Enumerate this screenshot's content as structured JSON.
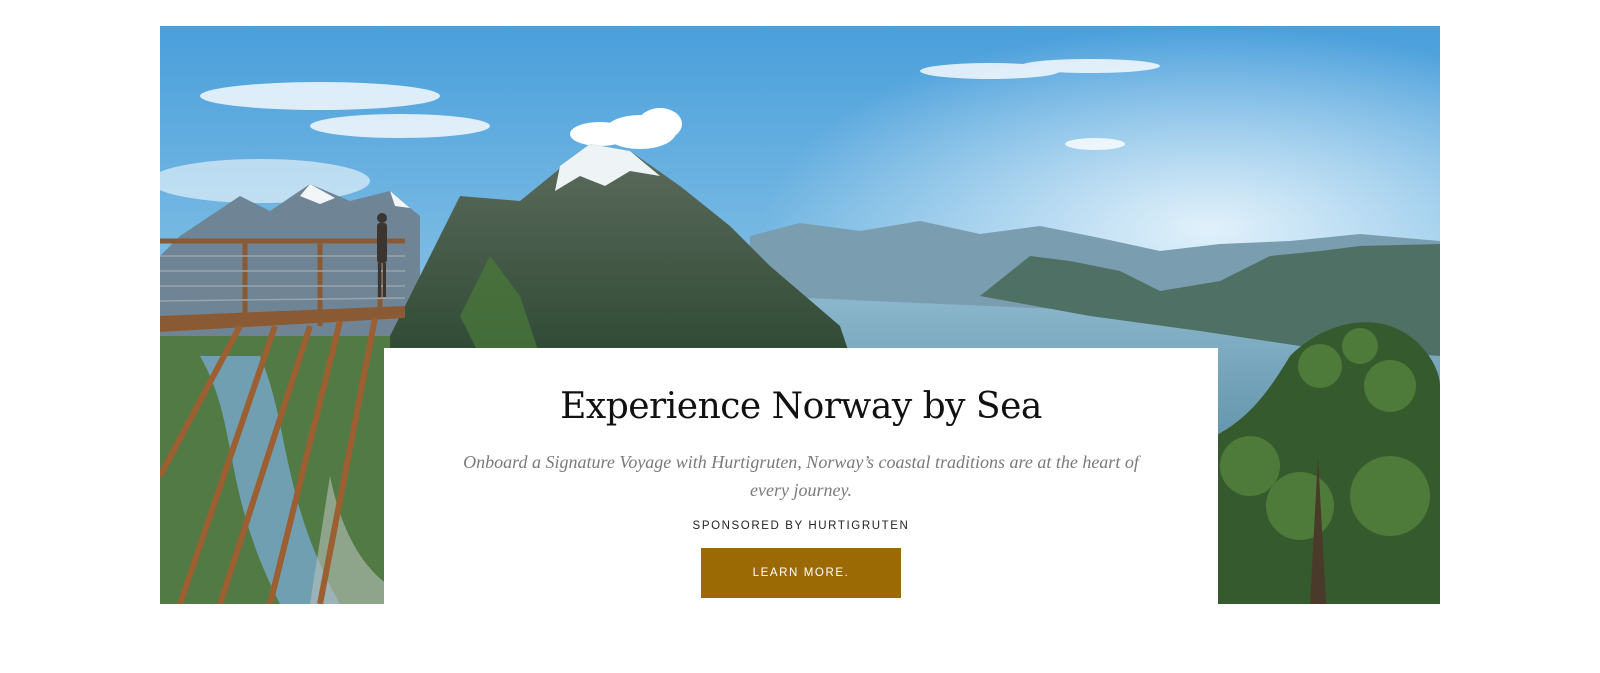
{
  "ad": {
    "title": "Experience Norway by Sea",
    "description": "Onboard a Signature Voyage with Hurtigruten, Norway’s coastal traditions are at the heart of every journey.",
    "sponsor": "SPONSORED BY HURTIGRUTEN",
    "cta_label": "LEARN MORE.",
    "colors": {
      "cta_background": "#9c6a05",
      "title_text": "#111111",
      "description_text": "#7a7a7a"
    }
  },
  "hero_image": {
    "subject": "fjord-viewpoint-photo"
  }
}
